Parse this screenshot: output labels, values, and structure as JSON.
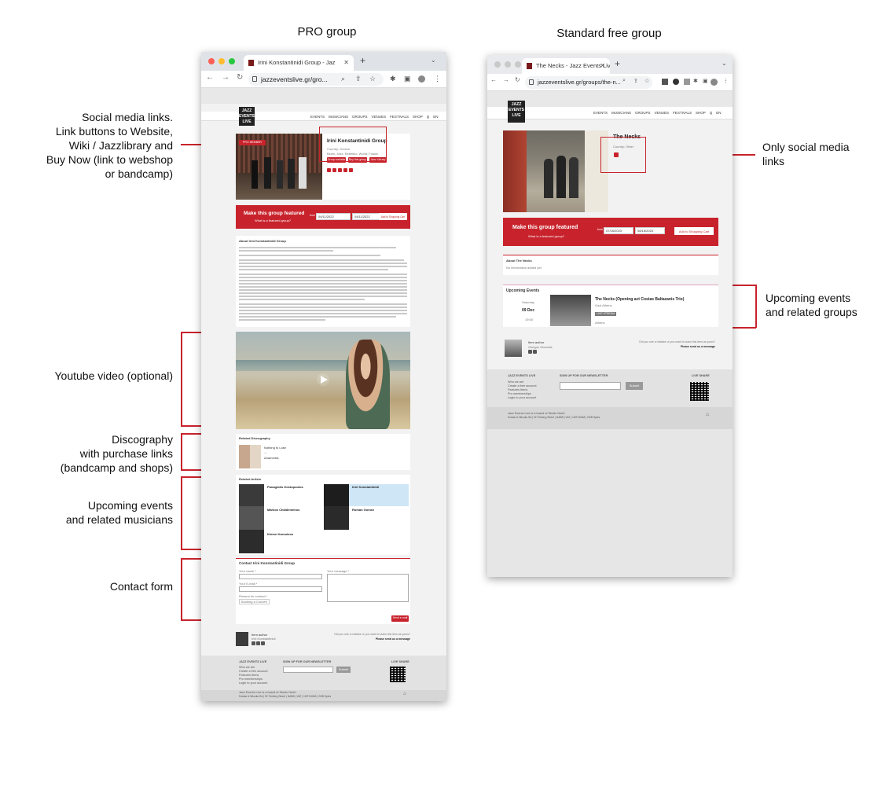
{
  "headings": {
    "pro": "PRO group",
    "free": "Standard free group"
  },
  "annotations": {
    "social": "Social media links.\nLink buttons to Website,\nWiki / Jazzlibrary and\nBuy Now (link to webshop\nor bandcamp)",
    "youtube": "Youtube video (optional)",
    "discography": "Discography\nwith purchase links\n(bandcamp and shops)",
    "events_musicians": "Upcoming events\nand related musicians",
    "contact": "Contact form",
    "only_social": "Only social media\nlinks",
    "events_groups": "Upcoming events\nand related groups"
  },
  "pro_window": {
    "tab_title": "Irini Konstantinidi Group - Jaz",
    "url": "jazzeventslive.gr/gro...",
    "logo_text": "JAZZ\nEVENTS\nLIVE",
    "menu": [
      "EVENTS",
      "MUSICIANS",
      "GROUPS",
      "VENUES",
      "FESTIVALS",
      "SHOP",
      "Q",
      "EN"
    ],
    "badge": "PRO MEMBER",
    "group_name": "Irini Konstantinidi Group",
    "group_meta": "Country: Greece",
    "group_meta2": "Blues, Jazz, Rebetiko, World, Fusion",
    "buttons": [
      "Group website",
      "Buy this group",
      "Jazz Library"
    ],
    "featured_title": "Make this group featured",
    "featured_sub": "What is a featured group?",
    "featured_from": "from",
    "date_from": "04/11/2022",
    "date_to": "04/11/2022",
    "cart_button": "Add to Shopping Cart",
    "about_title": "About Irini Konstantinidi Group",
    "discography_title": "Related Discography",
    "album1": "Nothing to Lose",
    "album2": "Anamnisis",
    "artists_title": "Related Artists",
    "artists": [
      "Panagiotis Kostopoulos",
      "Markos Chaidemenos",
      "Kimon Karoutzos",
      "Irini Konstantinidi",
      "Roman Gomez"
    ],
    "contact_title": "Contact Irini Konstantinidi Group",
    "your_name": "Your name *",
    "your_email": "Your E-mail *",
    "reason": "Reason for contact *",
    "reason_value": "Booking a Concert",
    "your_message": "Your message *",
    "send": "Send e-mail",
    "author_label": "Item author",
    "author_name": "Irini Konstantinidi",
    "mistake": "Did you see a mistake or you want to claim this item as yours?",
    "send_message": "Please send us a message",
    "footer_col1": "JAZZ EVENTS LIVE",
    "footer_links": [
      "Who we are",
      "Create a free account",
      "Features Items",
      "Pro memberships",
      "Login to your account"
    ],
    "newsletter": "SIGN UP FOR OUR NEWSLETTER",
    "submit": "Submit",
    "live_share": "LIVE SHARE",
    "copyright": "Jazz Events Live is a brand of Studio North",
    "address": "Kostas & Nikoula SA | 92 Timberg Street | NABB | VAT | 1MTC6048 | GEB Spies"
  },
  "free_window": {
    "tab_title": "The Necks - Jazz Events Live",
    "url": "jazzeventslive.gr/groups/the-n...",
    "logo_text": "JAZZ\nEVENTS\nLIVE",
    "menu": [
      "EVENTS",
      "MUSICIANS",
      "GROUPS",
      "VENUES",
      "FESTIVALS",
      "SHOP",
      "Q",
      "EN"
    ],
    "group_name": "The Necks",
    "group_meta": "Country: Other",
    "featured_title": "Make this group featured",
    "featured_sub": "What is a featured group?",
    "featured_from": "from",
    "date_from": "07/16/2023",
    "date_to": "08/16/2023",
    "cart_button": "Add to Shopping Cart",
    "about_title": "About The Necks",
    "about_text": "No information added yet",
    "events_title": "Upcoming Events",
    "event_day": "Saturday",
    "event_date": "09 Dec",
    "event_time": "19:00",
    "event_name": "The Necks (Opening act Costas Baltazanis Trio)",
    "event_venue": "Gazi Athens",
    "event_tag": "LIVE STREAM",
    "event_city": "Athens",
    "author_label": "Item author",
    "author_name": "Giorgos Giovanis",
    "mistake": "Did you see a mistake or you want to claim this item as yours?",
    "send_message": "Please send us a message",
    "footer_col1": "JAZZ EVENTS LIVE",
    "footer_links": [
      "Who we are",
      "Create a free account",
      "Features Items",
      "Pro memberships",
      "Login to your account"
    ],
    "newsletter": "SIGN UP FOR OUR NEWSLETTER",
    "submit": "Submit",
    "live_share": "LIVE SHARE",
    "copyright": "Jazz Events Live is a brand of Studio North",
    "address": "Kostas & Nikoula SA | 92 Timberg Street | NABB | VAT | 1MTC6048 | GEB Spies"
  },
  "colors": {
    "accent": "#c8232c",
    "footer": "#e2e2e2"
  }
}
